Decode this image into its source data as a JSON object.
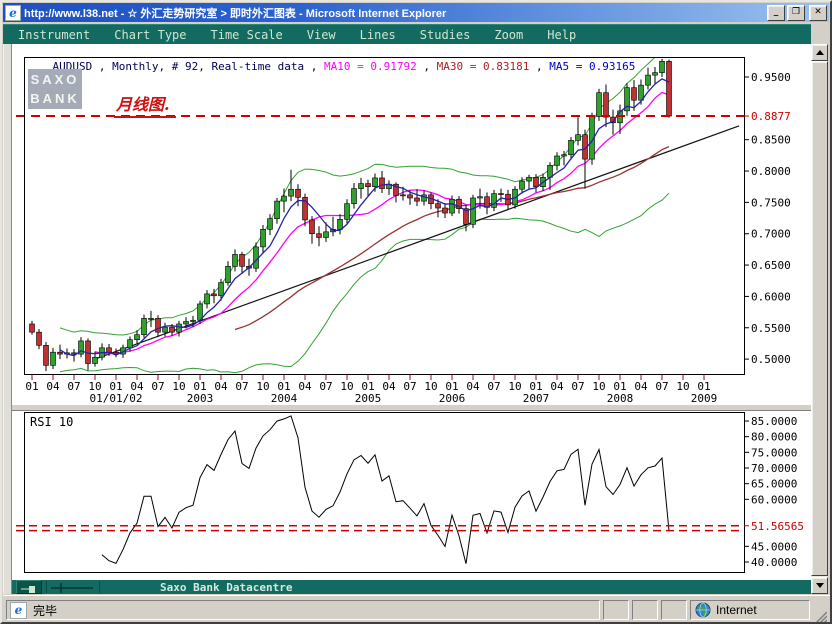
{
  "window": {
    "title": "http://www.l38.net - ☆ 外汇走势研究室 > 即时外汇图表 - Microsoft Internet Explorer",
    "minimize_glyph": "_",
    "maximize_glyph": "❐",
    "close_glyph": "✕"
  },
  "menu_bar": {
    "items": [
      "Instrument",
      "Chart Type",
      "Time Scale",
      "View",
      "Lines",
      "Studies",
      "Zoom",
      "Help"
    ]
  },
  "quote_header": {
    "info": "AUDUSD , Monthly, # 92, Real-time data",
    "sep": " , ",
    "ma10": "MA10 = 0.91792",
    "ma30": "MA30 = 0.83181",
    "ma5": "MA5 = 0.93165",
    "colors": {
      "info": "#000050",
      "ma10": "#ff00ff",
      "ma30": "#aa2222",
      "ma5": "#0000cc"
    }
  },
  "logo": {
    "line1": "SAXO",
    "line2": "BANK"
  },
  "annotation": "月线图.",
  "bottom_toolbar": {
    "label": "Saxo Bank Datacentre"
  },
  "status_bar": {
    "status_text": "完毕",
    "zone_label": "Internet"
  },
  "chart_data": [
    {
      "type": "candlestick",
      "symbol": "AUDUSD",
      "timeframe": "Monthly",
      "bar_count": 92,
      "y_axis": {
        "range_top": 0.9819,
        "range_bottom": 0.4762
      },
      "y_ticks": [
        {
          "label": "0.9500",
          "value": 0.95
        },
        {
          "label": "0.8877",
          "value": 0.8877,
          "color": "#cc0000"
        },
        {
          "label": "0.8500",
          "value": 0.85
        },
        {
          "label": "0.8000",
          "value": 0.8
        },
        {
          "label": "0.7500",
          "value": 0.75
        },
        {
          "label": "0.7000",
          "value": 0.7
        },
        {
          "label": "0.6500",
          "value": 0.65
        },
        {
          "label": "0.6000",
          "value": 0.6
        },
        {
          "label": "0.5500",
          "value": 0.55
        },
        {
          "label": "0.5000",
          "value": 0.5
        }
      ],
      "price_level": {
        "value": 0.8877,
        "color": "#cc0000"
      },
      "month_labels": [
        "01",
        "04",
        "07",
        "10",
        "01",
        "04",
        "07",
        "10",
        "01",
        "04",
        "07",
        "10",
        "01",
        "04",
        "07",
        "10",
        "01",
        "04",
        "07",
        "10",
        "01",
        "04",
        "07",
        "10",
        "01",
        "04",
        "07",
        "10",
        "01",
        "04",
        "07",
        "10",
        "01"
      ],
      "year_labels": [
        {
          "text": "01/01/02",
          "bar": 12
        },
        {
          "text": "2003",
          "bar": 24
        },
        {
          "text": "2004",
          "bar": 36
        },
        {
          "text": "2005",
          "bar": 48
        },
        {
          "text": "2006",
          "bar": 60
        },
        {
          "text": "2007",
          "bar": 72
        },
        {
          "text": "2008",
          "bar": 84
        },
        {
          "text": "2009",
          "bar": 96
        }
      ],
      "overlays": {
        "ma5_period": 5,
        "ma10_period": 10,
        "ma30_period": 30,
        "band_period": 20,
        "band_width": 2
      },
      "trendline": {
        "from_bar": 9,
        "from_price": 0.5,
        "to_bar": 101,
        "to_price": 0.872
      },
      "colors": {
        "up": "#2ea12e",
        "down": "#c03232",
        "wick": "#000000",
        "ma5": "#2222aa",
        "ma10": "#ff00ff",
        "ma30": "#993333",
        "band": "#33a133",
        "trend": "#111111",
        "level": "#cc0000",
        "x_tick": "#aa0022"
      },
      "candles": [
        [
          0.556,
          0.561,
          0.539,
          0.543
        ],
        [
          0.543,
          0.548,
          0.516,
          0.522
        ],
        [
          0.522,
          0.527,
          0.481,
          0.49
        ],
        [
          0.49,
          0.518,
          0.484,
          0.511
        ],
        [
          0.511,
          0.523,
          0.5,
          0.508
        ],
        [
          0.508,
          0.517,
          0.501,
          0.51
        ],
        [
          0.51,
          0.516,
          0.496,
          0.508
        ],
        [
          0.508,
          0.535,
          0.503,
          0.529
        ],
        [
          0.529,
          0.533,
          0.482,
          0.493
        ],
        [
          0.493,
          0.512,
          0.488,
          0.503
        ],
        [
          0.503,
          0.525,
          0.498,
          0.518
        ],
        [
          0.518,
          0.524,
          0.505,
          0.511
        ],
        [
          0.511,
          0.517,
          0.503,
          0.508
        ],
        [
          0.508,
          0.523,
          0.502,
          0.518
        ],
        [
          0.518,
          0.536,
          0.512,
          0.531
        ],
        [
          0.531,
          0.546,
          0.525,
          0.539
        ],
        [
          0.539,
          0.571,
          0.534,
          0.565
        ],
        [
          0.565,
          0.577,
          0.551,
          0.565
        ],
        [
          0.565,
          0.57,
          0.535,
          0.543
        ],
        [
          0.543,
          0.558,
          0.536,
          0.551
        ],
        [
          0.551,
          0.556,
          0.537,
          0.543
        ],
        [
          0.543,
          0.561,
          0.536,
          0.556
        ],
        [
          0.556,
          0.567,
          0.549,
          0.56
        ],
        [
          0.56,
          0.569,
          0.551,
          0.562
        ],
        [
          0.562,
          0.593,
          0.556,
          0.588
        ],
        [
          0.588,
          0.61,
          0.581,
          0.604
        ],
        [
          0.604,
          0.612,
          0.589,
          0.601
        ],
        [
          0.601,
          0.628,
          0.593,
          0.622
        ],
        [
          0.622,
          0.656,
          0.617,
          0.648
        ],
        [
          0.648,
          0.675,
          0.64,
          0.667
        ],
        [
          0.667,
          0.671,
          0.636,
          0.648
        ],
        [
          0.648,
          0.66,
          0.633,
          0.645
        ],
        [
          0.645,
          0.686,
          0.639,
          0.679
        ],
        [
          0.679,
          0.714,
          0.67,
          0.707
        ],
        [
          0.707,
          0.731,
          0.698,
          0.724
        ],
        [
          0.724,
          0.757,
          0.716,
          0.752
        ],
        [
          0.752,
          0.772,
          0.734,
          0.76
        ],
        [
          0.76,
          0.802,
          0.752,
          0.771
        ],
        [
          0.771,
          0.779,
          0.744,
          0.758
        ],
        [
          0.758,
          0.764,
          0.712,
          0.722
        ],
        [
          0.722,
          0.728,
          0.684,
          0.7
        ],
        [
          0.7,
          0.712,
          0.68,
          0.694
        ],
        [
          0.694,
          0.718,
          0.687,
          0.703
        ],
        [
          0.703,
          0.727,
          0.696,
          0.707
        ],
        [
          0.707,
          0.731,
          0.699,
          0.723
        ],
        [
          0.723,
          0.755,
          0.716,
          0.748
        ],
        [
          0.748,
          0.781,
          0.74,
          0.772
        ],
        [
          0.772,
          0.789,
          0.756,
          0.78
        ],
        [
          0.78,
          0.786,
          0.76,
          0.775
        ],
        [
          0.775,
          0.796,
          0.767,
          0.789
        ],
        [
          0.789,
          0.8,
          0.765,
          0.772
        ],
        [
          0.772,
          0.785,
          0.762,
          0.779
        ],
        [
          0.779,
          0.782,
          0.75,
          0.761
        ],
        [
          0.761,
          0.775,
          0.753,
          0.762
        ],
        [
          0.762,
          0.769,
          0.746,
          0.757
        ],
        [
          0.757,
          0.771,
          0.744,
          0.752
        ],
        [
          0.752,
          0.769,
          0.745,
          0.762
        ],
        [
          0.762,
          0.766,
          0.739,
          0.748
        ],
        [
          0.748,
          0.755,
          0.726,
          0.741
        ],
        [
          0.741,
          0.749,
          0.725,
          0.733
        ],
        [
          0.733,
          0.761,
          0.728,
          0.755
        ],
        [
          0.755,
          0.76,
          0.732,
          0.74
        ],
        [
          0.74,
          0.746,
          0.704,
          0.715
        ],
        [
          0.715,
          0.762,
          0.709,
          0.757
        ],
        [
          0.757,
          0.772,
          0.74,
          0.759
        ],
        [
          0.759,
          0.766,
          0.731,
          0.742
        ],
        [
          0.742,
          0.77,
          0.736,
          0.764
        ],
        [
          0.764,
          0.772,
          0.751,
          0.763
        ],
        [
          0.763,
          0.77,
          0.739,
          0.746
        ],
        [
          0.746,
          0.776,
          0.74,
          0.771
        ],
        [
          0.771,
          0.79,
          0.764,
          0.784
        ],
        [
          0.784,
          0.794,
          0.771,
          0.79
        ],
        [
          0.79,
          0.795,
          0.766,
          0.775
        ],
        [
          0.775,
          0.796,
          0.768,
          0.79
        ],
        [
          0.79,
          0.814,
          0.77,
          0.809
        ],
        [
          0.809,
          0.83,
          0.801,
          0.824
        ],
        [
          0.824,
          0.832,
          0.809,
          0.826
        ],
        [
          0.826,
          0.854,
          0.818,
          0.849
        ],
        [
          0.849,
          0.886,
          0.841,
          0.858
        ],
        [
          0.858,
          0.866,
          0.772,
          0.819
        ],
        [
          0.819,
          0.893,
          0.81,
          0.887
        ],
        [
          0.887,
          0.931,
          0.88,
          0.925
        ],
        [
          0.925,
          0.938,
          0.87,
          0.886
        ],
        [
          0.886,
          0.898,
          0.858,
          0.877
        ],
        [
          0.877,
          0.906,
          0.859,
          0.896
        ],
        [
          0.896,
          0.94,
          0.888,
          0.933
        ],
        [
          0.933,
          0.945,
          0.896,
          0.913
        ],
        [
          0.913,
          0.946,
          0.906,
          0.937
        ],
        [
          0.937,
          0.965,
          0.93,
          0.953
        ],
        [
          0.953,
          0.966,
          0.938,
          0.957
        ],
        [
          0.957,
          0.979,
          0.95,
          0.975
        ],
        [
          0.975,
          0.978,
          0.885,
          0.8877
        ]
      ]
    },
    {
      "type": "line",
      "title": "RSI 10",
      "period": 10,
      "source": "close",
      "y_ticks": [
        {
          "label": "85.0000",
          "value": 85
        },
        {
          "label": "80.0000",
          "value": 80
        },
        {
          "label": "75.0000",
          "value": 75
        },
        {
          "label": "70.0000",
          "value": 70
        },
        {
          "label": "65.0000",
          "value": 65
        },
        {
          "label": "60.0000",
          "value": 60
        },
        {
          "label": "51.56565",
          "value": 51.56565,
          "color": "#cc0000"
        },
        {
          "label": "45.0000",
          "value": 45
        },
        {
          "label": "40.0000",
          "value": 40
        }
      ],
      "dashed_levels": [
        51.56565,
        50.0
      ],
      "colors": {
        "line": "#000000",
        "level": "#cc0000"
      }
    }
  ]
}
